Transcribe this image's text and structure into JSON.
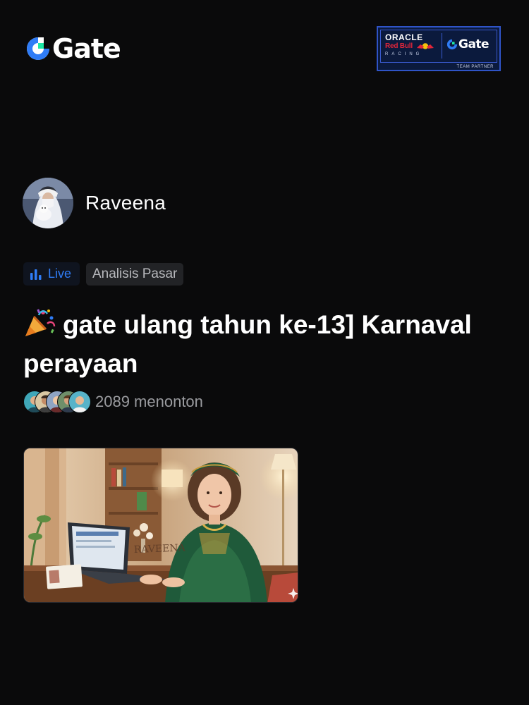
{
  "header": {
    "brand_name": "Gate",
    "brand_color": "#2f7cf6",
    "partner_badge": {
      "line1": "ORACLE",
      "line2": "Red Bull",
      "line3": "RACING",
      "gate_label": "Gate",
      "caption": "TEAM PARTNER"
    }
  },
  "stream": {
    "streamer_name": "Raveena",
    "live_label": "Live",
    "category_label": "Analisis Pasar",
    "title": "gate ulang tahun ke-13] Karnaval perayaan",
    "title_icon": "party-popper-icon",
    "viewer_count_text": "2089 menonton",
    "thumbnail_watermark": "RAVEENA"
  },
  "colors": {
    "background": "#0a0a0b",
    "accent_blue": "#2f7cf6",
    "muted_text": "#9a9b9f",
    "tag_bg": "#222326"
  }
}
